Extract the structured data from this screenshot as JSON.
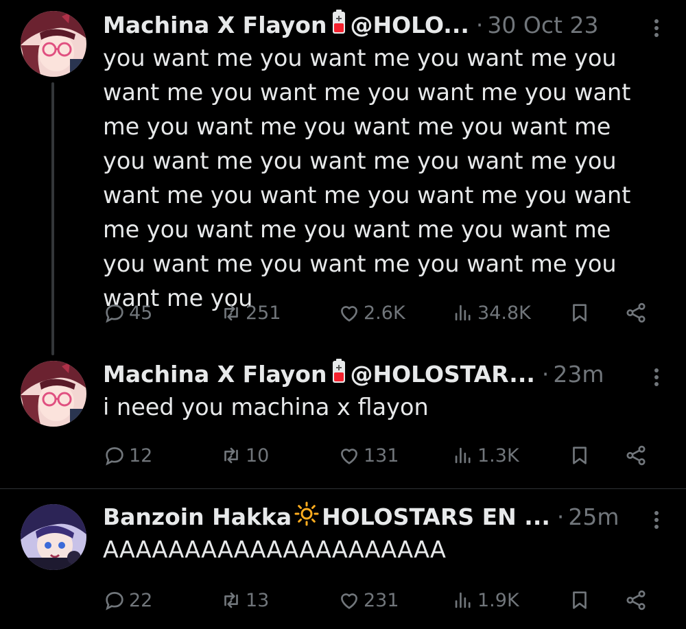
{
  "tweets": [
    {
      "display_name": "Machina X Flayon",
      "handle": "@HOLO...",
      "separator": "·",
      "time": "30 Oct 23",
      "text": "you want me you want me you want me you want me you want me you want me you want me you want me you want me you want me you want me you want me you want me you want me you want me you want me you want me you want me you want me you want me you want me you want me you want me you want me you",
      "stats": {
        "replies": "45",
        "reposts": "251",
        "likes": "2.6K",
        "views": "34.8K"
      }
    },
    {
      "display_name": "Machina X Flayon",
      "handle": "@HOLOSTAR...",
      "separator": "·",
      "time": "23m",
      "text": "i need you machina x flayon",
      "stats": {
        "replies": "12",
        "reposts": "10",
        "likes": "131",
        "views": "1.3K"
      }
    },
    {
      "display_name": "Banzoin Hakka",
      "handle": "HOLOSTARS EN ...",
      "separator": "·",
      "time": "25m",
      "text": "AAAAAAAAAAAAAAAAAAAAA",
      "stats": {
        "replies": "22",
        "reposts": "13",
        "likes": "231",
        "views": "1.9K"
      }
    }
  ],
  "icons": {
    "badge_1": "battery-low-icon",
    "badge_2": "battery-low-icon",
    "badge_3": "sun-icon",
    "reply": "reply-icon",
    "repost": "repost-icon",
    "like": "heart-icon",
    "views": "views-icon",
    "bookmark": "bookmark-icon",
    "share": "share-icon",
    "more": "more-vertical-icon"
  },
  "colors": {
    "background": "#000000",
    "primary_text": "#e7e9ea",
    "secondary_text": "#71767b",
    "divider": "#2f3336",
    "battery_red": "#f4212e",
    "sun_orange": "#ffad1f"
  }
}
